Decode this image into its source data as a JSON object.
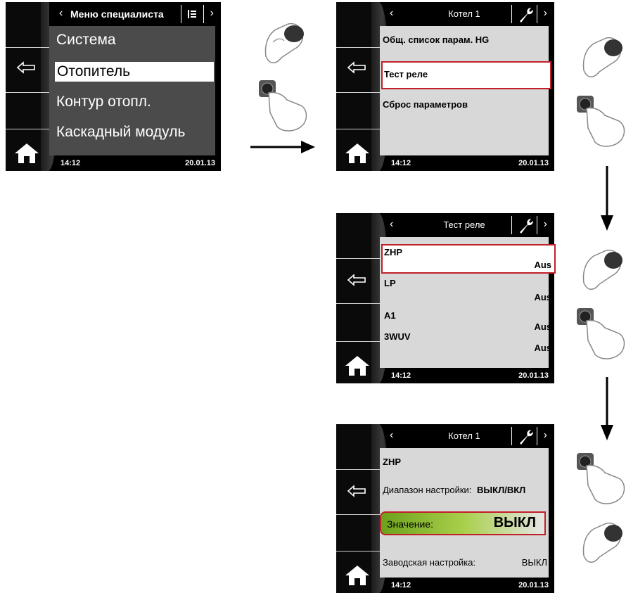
{
  "time": "14:12",
  "date": "20.01.13",
  "screen1": {
    "title": "Меню специалиста",
    "items": [
      "Система",
      "Отопитель",
      "Контур отопл.",
      "Каскадный модуль"
    ]
  },
  "screen2": {
    "title": "Котел 1",
    "items": [
      "Общ. список парам. HG",
      "Тест реле",
      "Сброс параметров"
    ]
  },
  "screen3": {
    "title": "Тест реле",
    "rows": [
      {
        "name": "ZHP",
        "value": "Aus"
      },
      {
        "name": "LP",
        "value": "Aus"
      },
      {
        "name": "A1",
        "value": "Aus"
      },
      {
        "name": "3WUV",
        "value": "Aus"
      }
    ]
  },
  "screen4": {
    "title": "Котел 1",
    "param": "ZHP",
    "range_label": "Диапазон настройки:",
    "range_value": "ВЫКЛ/ВКЛ",
    "value_label": "Значение:",
    "value": "ВЫКЛ",
    "factory_label": "Заводская настройка:",
    "factory_value": "ВЫКЛ"
  },
  "colors": {
    "highlight": "#c0202a",
    "value_green": "#8fc22a"
  }
}
